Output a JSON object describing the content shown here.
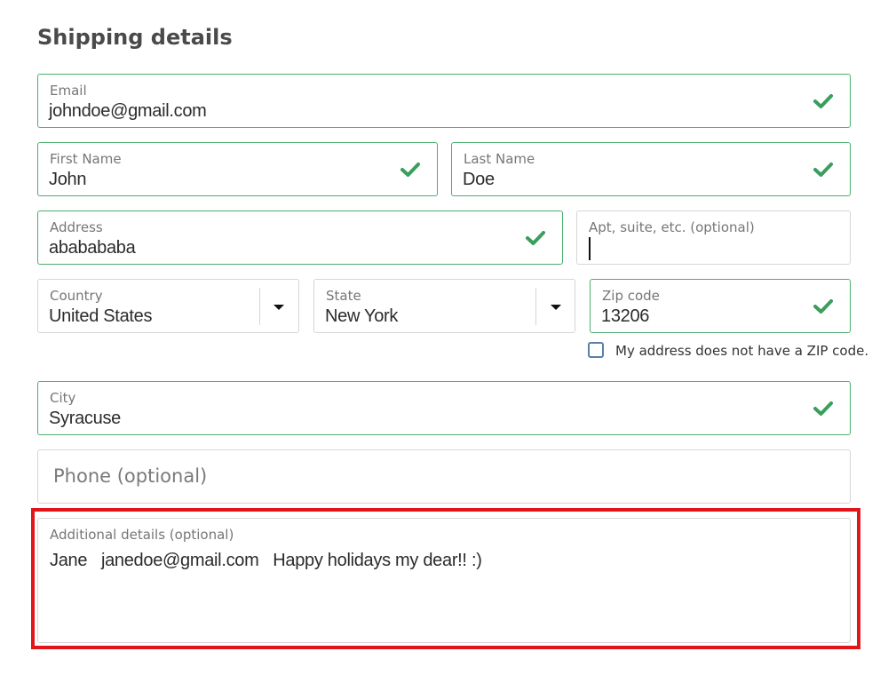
{
  "form": {
    "title": "Shipping details",
    "email": {
      "label": "Email",
      "value": "johndoe@gmail.com"
    },
    "first_name": {
      "label": "First Name",
      "value": "John"
    },
    "last_name": {
      "label": "Last Name",
      "value": "Doe"
    },
    "address": {
      "label": "Address",
      "value": "ababababa"
    },
    "apt": {
      "label": "Apt, suite, etc. (optional)",
      "value": ""
    },
    "country": {
      "label": "Country",
      "value": "United States"
    },
    "state": {
      "label": "State",
      "value": "New York"
    },
    "zip": {
      "label": "Zip code",
      "value": "13206"
    },
    "no_zip_checkbox": {
      "label": "My address does not have a ZIP code.",
      "checked": false
    },
    "city": {
      "label": "City",
      "value": "Syracuse"
    },
    "phone": {
      "placeholder": "Phone (optional)",
      "value": ""
    },
    "additional": {
      "label": "Additional details (optional)",
      "value": "Jane   janedoe@gmail.com   Happy holidays my dear!! :)"
    }
  },
  "colors": {
    "valid": "#4caf6e",
    "highlight": "#e0161b",
    "checkbox": "#5a7fa8"
  },
  "icons": {
    "valid": "checkmark-icon",
    "dropdown": "chevron-down-icon"
  }
}
